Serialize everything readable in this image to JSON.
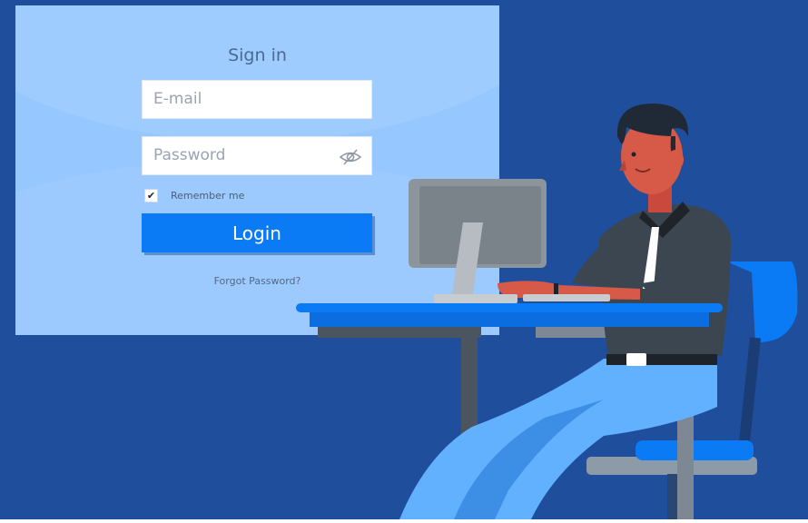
{
  "form": {
    "title": "Sign in",
    "email_placeholder": "E-mail",
    "password_placeholder": "Password",
    "remember_label": "Remember me",
    "remember_checked": true,
    "login_label": "Login",
    "forgot_label": "Forgot Password?"
  },
  "icons": {
    "password_toggle": "eye-slash-icon",
    "checkbox_mark": "checkmark-icon"
  },
  "colors": {
    "background": "#1f4e9c",
    "panel": "#96c7ff",
    "button": "#0a7bf5"
  }
}
